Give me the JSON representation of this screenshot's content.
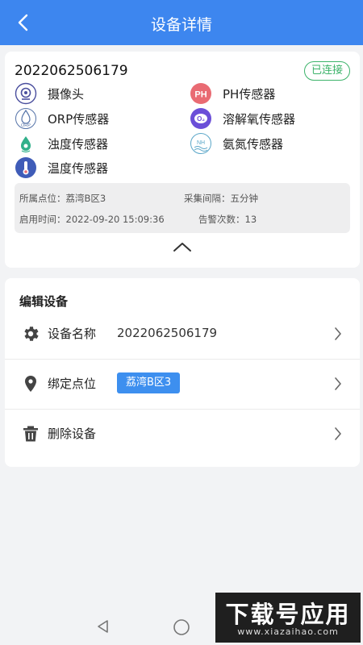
{
  "header": {
    "title": "设备详情"
  },
  "device": {
    "id": "2022062506179",
    "status": "已连接"
  },
  "sensors": [
    {
      "label": "摄像头",
      "icon": "camera-icon"
    },
    {
      "label": "PH传感器",
      "icon": "ph-icon",
      "icon_text": "PH"
    },
    {
      "label": "ORP传感器",
      "icon": "orp-icon",
      "icon_text": "ORP"
    },
    {
      "label": "溶解氧传感器",
      "icon": "dissolved-oxygen-icon",
      "icon_text": "O₂"
    },
    {
      "label": "浊度传感器",
      "icon": "turbidity-icon"
    },
    {
      "label": "氨氮传感器",
      "icon": "ammonia-icon",
      "icon_text": "NH"
    },
    {
      "label": "温度传感器",
      "icon": "thermometer-icon"
    }
  ],
  "info": {
    "location": "所属点位：荔湾B区3",
    "interval": "采集间隔：五分钟",
    "start_time": "启用时间：2022-09-20 15:09:36",
    "alarm_count": "告警次数：13"
  },
  "edit": {
    "title": "编辑设备",
    "name_label": "设备名称",
    "name_value": "2022062506179",
    "bind_label": "绑定点位",
    "bind_value": "荔湾B区3",
    "delete_label": "删除设备"
  },
  "watermark": {
    "main": "下载号应用",
    "sub": "www.xiazaihao.com"
  },
  "colors": {
    "primary": "#3d86ef",
    "connected": "#3cb36a",
    "ph": "#e96b73",
    "oxygen": "#6b4fd8"
  }
}
